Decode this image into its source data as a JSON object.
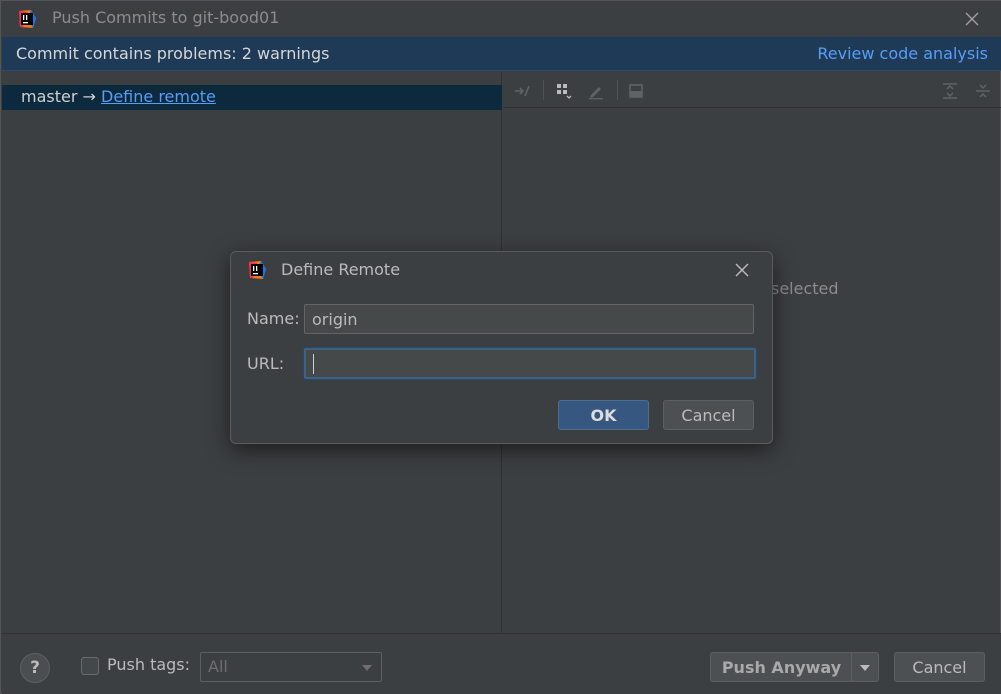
{
  "window": {
    "title": "Push Commits to git-bood01"
  },
  "banner": {
    "message": "Commit contains problems: 2 warnings",
    "link": "Review code analysis"
  },
  "branch": {
    "name": "master",
    "arrow": "→",
    "define_link": "Define remote"
  },
  "right_pane": {
    "status_fragment": "selected"
  },
  "bottom": {
    "help_label": "?",
    "push_tags_label": "Push tags:",
    "push_tags_checked": false,
    "tags_select_value": "All",
    "push_anyway_label": "Push Anyway",
    "cancel_label": "Cancel"
  },
  "dialog": {
    "title": "Define Remote",
    "name_label": "Name:",
    "name_value": "origin",
    "url_label": "URL:",
    "url_value": "",
    "ok_label": "OK",
    "cancel_label": "Cancel"
  },
  "colors": {
    "background": "#3c3f41",
    "banner": "#1e3a57",
    "link": "#589df6",
    "selection": "#0d293e",
    "primary_button": "#365880"
  }
}
